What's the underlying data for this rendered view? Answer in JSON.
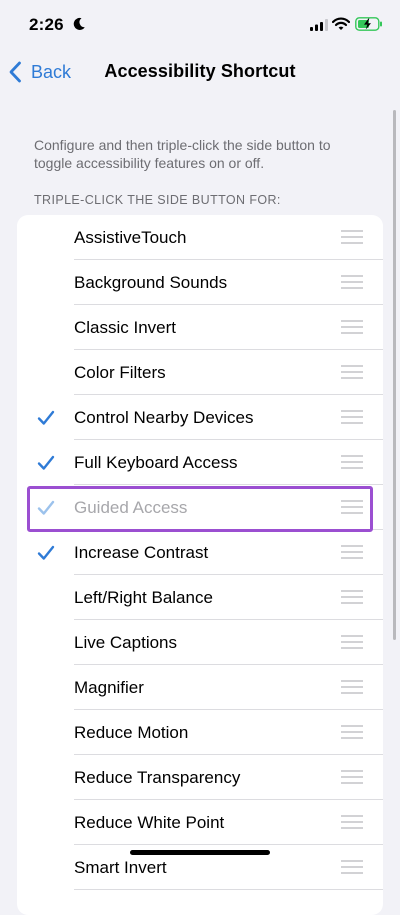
{
  "status_bar": {
    "time": "2:26",
    "moon_icon": "moon-icon",
    "signal_icon": "cellular-signal-icon",
    "wifi_icon": "wifi-icon",
    "battery_icon": "battery-charging-icon"
  },
  "nav": {
    "back_label": "Back",
    "title": "Accessibility Shortcut"
  },
  "description": "Configure and then triple-click the side button to toggle accessibility features on or off.",
  "section_header": "TRIPLE-CLICK THE SIDE BUTTON FOR:",
  "colors": {
    "accent": "#2f7bd6",
    "highlight": "#9b4fd1",
    "background": "#f2f2f7"
  },
  "items": [
    {
      "label": "AssistiveTouch",
      "checked": false,
      "dimmed": false
    },
    {
      "label": "Background Sounds",
      "checked": false,
      "dimmed": false
    },
    {
      "label": "Classic Invert",
      "checked": false,
      "dimmed": false
    },
    {
      "label": "Color Filters",
      "checked": false,
      "dimmed": false
    },
    {
      "label": "Control Nearby Devices",
      "checked": true,
      "dimmed": false
    },
    {
      "label": "Full Keyboard Access",
      "checked": true,
      "dimmed": false
    },
    {
      "label": "Guided Access",
      "checked": true,
      "dimmed": true
    },
    {
      "label": "Increase Contrast",
      "checked": true,
      "dimmed": false
    },
    {
      "label": "Left/Right Balance",
      "checked": false,
      "dimmed": false
    },
    {
      "label": "Live Captions",
      "checked": false,
      "dimmed": false
    },
    {
      "label": "Magnifier",
      "checked": false,
      "dimmed": false
    },
    {
      "label": "Reduce Motion",
      "checked": false,
      "dimmed": false
    },
    {
      "label": "Reduce Transparency",
      "checked": false,
      "dimmed": false
    },
    {
      "label": "Reduce White Point",
      "checked": false,
      "dimmed": false
    },
    {
      "label": "Smart Invert",
      "checked": false,
      "dimmed": false
    }
  ]
}
